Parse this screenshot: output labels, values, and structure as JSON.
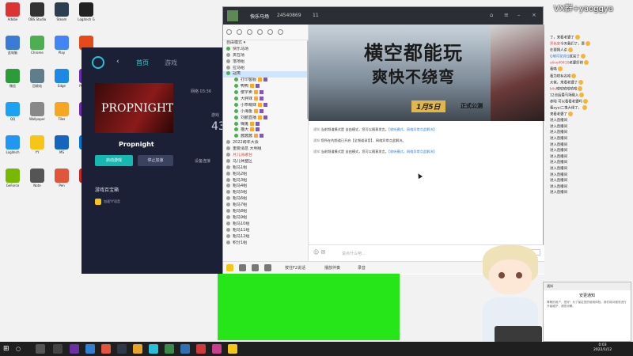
{
  "overlay": {
    "vx_text": "VX群+yaoggya"
  },
  "launcher": {
    "back": "‹",
    "tab_home": "首页",
    "tab_games": "游戏",
    "game_title": "Propnight",
    "cover_text": "PROPNIGHT",
    "start_button": "启动游戏",
    "stop_button": "停止加速",
    "settings": "设备连接",
    "side_label1": "网络 03:36",
    "side_label2": "游戏",
    "side_number": "43",
    "treasure": "游戏百宝箱",
    "yy_text": "加速YY语音"
  },
  "yy": {
    "channel_name": "快乐马场",
    "channel_id": "24540869",
    "online_count": "11",
    "channels": [
      {
        "label": "自由模式 ▾",
        "type": "head"
      },
      {
        "label": "快乐马场",
        "type": "main"
      },
      {
        "label": "夹在场",
        "type": "sub"
      },
      {
        "label": "落地组",
        "type": "sub"
      },
      {
        "label": "拉马组",
        "type": "sub"
      },
      {
        "label": "冠夷",
        "type": "sel"
      },
      {
        "label": "打印客服",
        "type": "user"
      },
      {
        "label": "鸭鸭",
        "type": "user"
      },
      {
        "label": "傻字卖",
        "type": "user"
      },
      {
        "label": "大胖妹",
        "type": "user"
      },
      {
        "label": "小乖萌妹",
        "type": "user"
      },
      {
        "label": "小海鱼",
        "type": "user"
      },
      {
        "label": "刘鹏直播",
        "type": "user"
      },
      {
        "label": "嗨鬼",
        "type": "user"
      },
      {
        "label": "猫大",
        "type": "user"
      },
      {
        "label": "酱酱酱",
        "type": "user"
      },
      {
        "label": "2022跨年大会",
        "type": "sub"
      },
      {
        "label": "重要消息 大明组",
        "type": "sub"
      },
      {
        "label": "月儿清歌台",
        "type": "red"
      },
      {
        "label": "马儿休整区",
        "type": "sub"
      },
      {
        "label": "粗马1组",
        "type": "sub"
      },
      {
        "label": "粗马2组",
        "type": "sub"
      },
      {
        "label": "粗马3组",
        "type": "sub"
      },
      {
        "label": "粗马4组",
        "type": "sub"
      },
      {
        "label": "粗马5组",
        "type": "sub"
      },
      {
        "label": "粗马6组",
        "type": "sub"
      },
      {
        "label": "粗马7组",
        "type": "sub"
      },
      {
        "label": "粗马8组",
        "type": "sub"
      },
      {
        "label": "粗马9组",
        "type": "sub"
      },
      {
        "label": "粗马10组",
        "type": "sub"
      },
      {
        "label": "粗马11组",
        "type": "sub"
      },
      {
        "label": "粗马12组",
        "type": "sub"
      },
      {
        "label": "积分1组",
        "type": "sub"
      }
    ],
    "banner": {
      "line1": "横空都能玩",
      "line2": "爽快不绕弯",
      "date": "1月5日",
      "launch": "正式公测"
    },
    "notices": [
      {
        "prefix": "通知:",
        "text": "当前频道模式是 自由模式，您可以随意发言。",
        "link": "【收听模式，网络异常点此解决】"
      },
      {
        "prefix": "通知:",
        "text": "您所在的频道已开启【全频道录音】，网络异常点此解决。",
        "link": ""
      },
      {
        "prefix": "通知:",
        "text": "当前频道模式是 自由模式，您可以随意发言。",
        "link": "【收听模式，网络异常点此解决】"
      }
    ],
    "input_placeholder": "说点什么吧...",
    "bottom_tools": [
      "按住F2说话",
      "播放伴奏",
      "录音"
    ]
  },
  "chat": [
    {
      "user": "",
      "text": "了，来看老婆了"
    },
    {
      "user": "黑色安",
      "text": "今天我们了，要"
    },
    {
      "user": "",
      "text": "在要揭人杀"
    },
    {
      "user": "Q萌可花花Q",
      "text": "就完了"
    },
    {
      "user": "alive40410",
      "text": "老婆好帅"
    },
    {
      "user": "",
      "text": "看咯"
    },
    {
      "user": "",
      "text": "看为啥有名哈"
    },
    {
      "user": "",
      "text": "大佬，来看老婆了"
    },
    {
      "user": "bilu",
      "text": "哈哈哈哈哈哈"
    },
    {
      "user": "",
      "text": "12点后最马场融入"
    },
    {
      "user": "",
      "text": "赤啦 可以看看老婆吗"
    },
    {
      "user": "",
      "text": "看ayui二鬼大佬了，"
    },
    {
      "user": "",
      "text": "来看老婆了"
    },
    {
      "user": "",
      "text": "进入直播间"
    },
    {
      "user": "",
      "text": "进入直播间"
    },
    {
      "user": "",
      "text": "进入直播间"
    },
    {
      "user": "",
      "text": "进入直播间"
    },
    {
      "user": "",
      "text": "进入直播间"
    },
    {
      "user": "",
      "text": "进入直播间"
    },
    {
      "user": "",
      "text": "进入直播间"
    },
    {
      "user": "",
      "text": "进入直播间"
    },
    {
      "user": "",
      "text": "进入直播间"
    },
    {
      "user": "",
      "text": "进入直播间"
    },
    {
      "user": "",
      "text": "进入直播间"
    },
    {
      "user": "",
      "text": "进入直播间"
    },
    {
      "user": "",
      "text": "进入直播间"
    }
  ],
  "notification": {
    "header": "通知",
    "title": "安更通知",
    "body": "尊敬的用户，您好！为了保证您的使用体验，我们将对服务进行升级维护，请您谅解。"
  },
  "desktop_icons": [
    "Adobe",
    "OBS Studio",
    "Steam",
    "Logitech G",
    "此电脑",
    "Chrome",
    "Play",
    "VS",
    "微信",
    "回收站",
    "Edge",
    "Premiere",
    "QQ",
    "Wallpaper",
    "Files",
    "After",
    "Logitech",
    "YY",
    "MS",
    "Store",
    "GeForce",
    "Note",
    "Pen",
    "WPS"
  ],
  "taskbar": {
    "time": "0:03",
    "date": "2022/1/12"
  }
}
